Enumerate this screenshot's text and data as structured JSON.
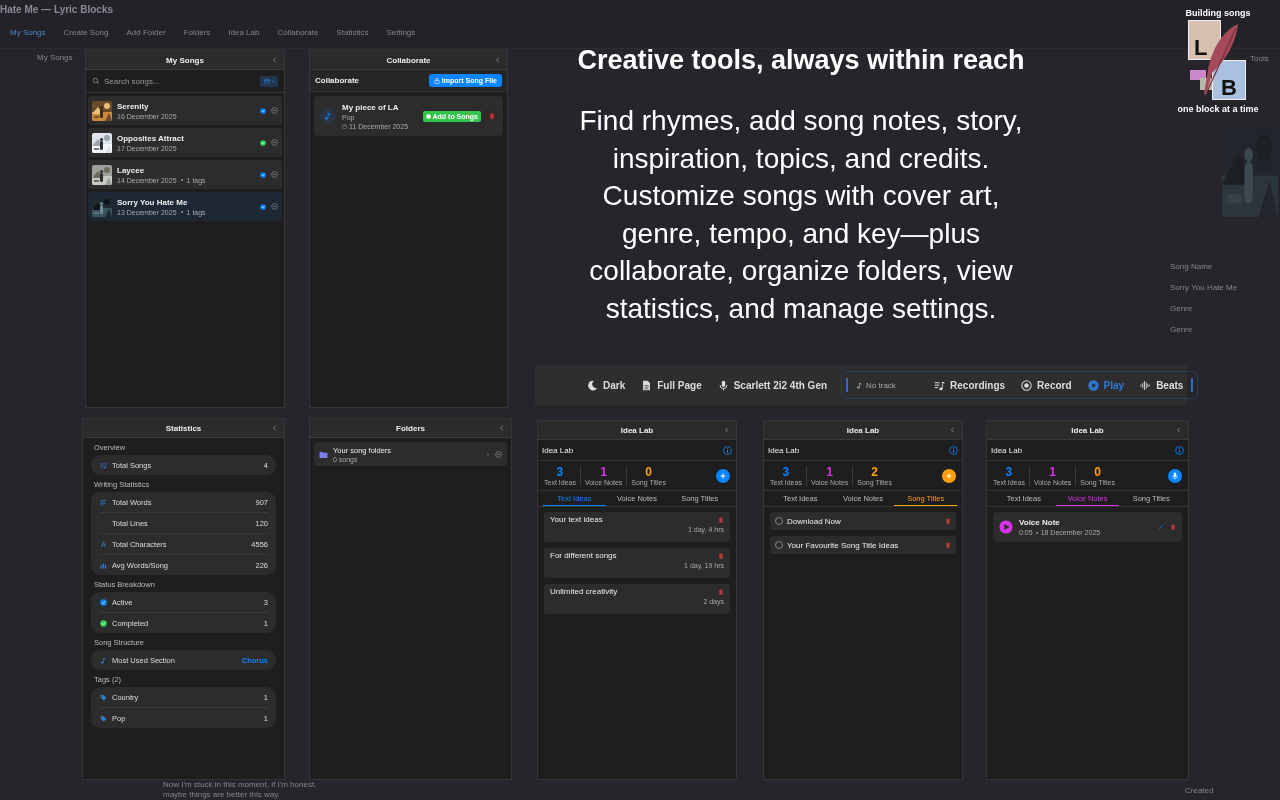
{
  "background_app": {
    "title": "Hate Me — Lyric Blocks",
    "nav": [
      {
        "label": "My Songs",
        "selected": true
      },
      {
        "label": "Create Song",
        "selected": false
      },
      {
        "label": "Add Folder",
        "selected": false
      },
      {
        "label": "Folders",
        "selected": false
      },
      {
        "label": "Idea Lab",
        "selected": false
      },
      {
        "label": "Collaborate",
        "selected": false
      },
      {
        "label": "Statistics",
        "selected": false
      },
      {
        "label": "Settings",
        "selected": false
      }
    ],
    "sidebar_heading": "My Songs",
    "tools_label": "Tools",
    "details": [
      "Song Name",
      "Sorry You Hate Me",
      "Genre",
      "Genre"
    ],
    "lyrics": [
      "Now I'm stuck in this moment, if I'm honest,",
      "maybe things are better this way."
    ],
    "created_label": "Created"
  },
  "headline": "Creative tools, always within reach",
  "description": "Find rhymes, add song notes, story, inspiration, topics, and credits. Customize songs with cover art, genre, tempo, and key—plus collaborate, organize folders, view statistics, and manage settings.",
  "logo": {
    "top_text": "Building songs",
    "letters": [
      "L",
      "B"
    ],
    "bottom_text": "one block at a time"
  },
  "my_songs": {
    "title": "My Songs",
    "search": {
      "placeholder": "Search songs..."
    },
    "songs": [
      {
        "title": "Serenity",
        "date": "16 December 2025",
        "color": "#0a84ff",
        "selected": false
      },
      {
        "title": "Opposites Attract",
        "date": "17 December 2025",
        "color": "#30d158",
        "selected": false
      },
      {
        "title": "Laycee",
        "date": "14 December 2025",
        "tags": "1 tags",
        "color": "#0a84ff",
        "selected": false
      },
      {
        "title": "Sorry You Hate Me",
        "date": "13 December 2025",
        "tags": "1 tags",
        "color": "#0a84ff",
        "selected": true
      }
    ]
  },
  "collaborate": {
    "title": "Collaborate",
    "heading": "Collaborate",
    "import_button": "Import Song File",
    "items": [
      {
        "title": "My piece of LA",
        "genre": "Pop",
        "date": "11 December 2025",
        "add_button": "Add to Songs"
      }
    ]
  },
  "toolbar": {
    "items": [
      {
        "kind": "theme",
        "label": "Dark",
        "active": false
      },
      {
        "kind": "page",
        "label": "Full Page",
        "active": false
      },
      {
        "kind": "input",
        "label": "Scarlett 2i2 4th Gen",
        "active": false
      }
    ],
    "track": {
      "label": "No track"
    },
    "player": [
      {
        "kind": "recordings",
        "label": "Recordings",
        "active": false
      },
      {
        "kind": "record",
        "label": "Record",
        "active": false
      },
      {
        "kind": "play",
        "label": "Play",
        "active": true
      },
      {
        "kind": "beats",
        "label": "Beats",
        "active": false
      }
    ]
  },
  "statistics": {
    "title": "Statistics",
    "sections": [
      {
        "heading": "Overview",
        "rows": [
          {
            "kind": "songs",
            "label": "Total Songs",
            "value": "4",
            "accent": false
          }
        ]
      },
      {
        "heading": "Writing Statistics",
        "rows": [
          {
            "kind": "words",
            "label": "Total Words",
            "value": "907",
            "accent": false
          },
          {
            "kind": "plain",
            "label": "Total Lines",
            "value": "120",
            "accent": false
          },
          {
            "kind": "characters",
            "label": "Total Characters",
            "value": "4556",
            "accent": false
          },
          {
            "kind": "average",
            "label": "Avg Words/Song",
            "value": "226",
            "accent": false
          }
        ]
      },
      {
        "heading": "Status Breakdown",
        "rows": [
          {
            "kind": "status",
            "label": "Active",
            "value": "3",
            "color": "#0a84ff",
            "accent": false
          },
          {
            "kind": "status",
            "label": "Completed",
            "value": "1",
            "color": "#30d158",
            "accent": false
          }
        ]
      },
      {
        "heading": "Song Structure",
        "rows": [
          {
            "kind": "section",
            "label": "Most Used Section",
            "value": "Chorus",
            "accent": true
          }
        ]
      },
      {
        "heading": "Tags (2)",
        "rows": [
          {
            "kind": "tag",
            "label": "Country",
            "value": "1",
            "accent": false
          },
          {
            "kind": "tag",
            "label": "Pop",
            "value": "1",
            "accent": false
          }
        ]
      }
    ]
  },
  "folders": {
    "title": "Folders",
    "items": [
      {
        "name": "Your song folders",
        "count": "0 songs"
      }
    ]
  },
  "idea_labs": [
    {
      "title": "Idea Lab",
      "heading": "Idea Lab",
      "kind": "text_ideas",
      "counts": [
        {
          "value": "3",
          "label": "Text Ideas",
          "color": "#0a84ff"
        },
        {
          "value": "1",
          "label": "Voice Notes",
          "color": "#d633e6"
        },
        {
          "value": "0",
          "label": "Song Titles",
          "color": "#ff9f0a"
        }
      ],
      "action": {
        "kind": "add",
        "color": "#0a84ff"
      },
      "tabs": [
        {
          "label": "Text Ideas",
          "selected": true
        },
        {
          "label": "Voice Notes",
          "selected": false
        },
        {
          "label": "Song Titles",
          "selected": false
        }
      ],
      "items": [
        {
          "text": "Your text ideas",
          "age": "1 day, 4 hrs"
        },
        {
          "text": "For different songs",
          "age": "1 day, 19 hrs"
        },
        {
          "text": "Unlimited creativity",
          "age": "2 days"
        }
      ]
    },
    {
      "title": "Idea Lab",
      "heading": "Idea Lab",
      "kind": "song_titles",
      "counts": [
        {
          "value": "3",
          "label": "Text Ideas",
          "color": "#0a84ff"
        },
        {
          "value": "1",
          "label": "Voice Notes",
          "color": "#d633e6"
        },
        {
          "value": "2",
          "label": "Song Titles",
          "color": "#ff9f0a"
        }
      ],
      "action": {
        "kind": "add",
        "color": "#ff9f0a"
      },
      "tabs": [
        {
          "label": "Text Ideas",
          "selected": false
        },
        {
          "label": "Voice Notes",
          "selected": false
        },
        {
          "label": "Song Titles",
          "selected": true
        }
      ],
      "items": [
        {
          "text": "Download Now",
          "checked": false
        },
        {
          "text": "Your Favourite Song Title Ideas",
          "checked": false
        }
      ]
    },
    {
      "title": "Idea Lab",
      "heading": "Idea Lab",
      "kind": "voice_notes",
      "counts": [
        {
          "value": "3",
          "label": "Text Ideas",
          "color": "#0a84ff"
        },
        {
          "value": "1",
          "label": "Voice Notes",
          "color": "#d633e6"
        },
        {
          "value": "0",
          "label": "Song Titles",
          "color": "#ff9f0a"
        }
      ],
      "action": {
        "kind": "mic",
        "color": "#0a84ff"
      },
      "tabs": [
        {
          "label": "Text Ideas",
          "selected": false
        },
        {
          "label": "Voice Notes",
          "selected": true
        },
        {
          "label": "Song Titles",
          "selected": false
        }
      ],
      "items": [
        {
          "text": "Voice Note",
          "duration": "0:05",
          "date": "18 December 2025"
        }
      ]
    }
  ]
}
